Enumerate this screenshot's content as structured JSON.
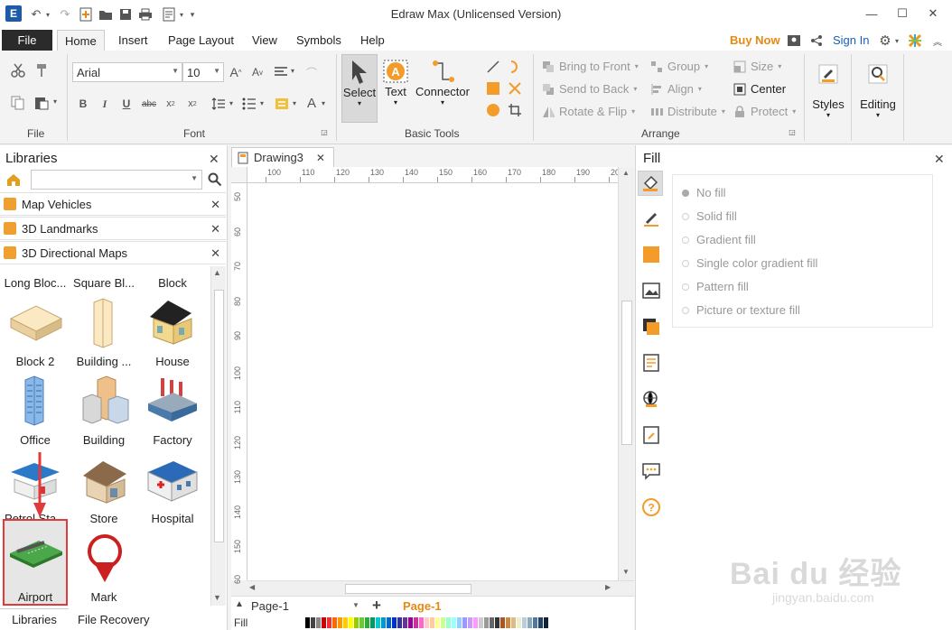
{
  "window": {
    "title": "Edraw Max (Unlicensed Version)",
    "logo_text": "E"
  },
  "menu": {
    "file": "File",
    "tabs": [
      "Home",
      "Insert",
      "Page Layout",
      "View",
      "Symbols",
      "Help"
    ],
    "buy_now": "Buy Now",
    "sign_in": "Sign In"
  },
  "ribbon": {
    "groups": {
      "file": "File",
      "font": "Font",
      "basic_tools": "Basic Tools",
      "arrange": "Arrange"
    },
    "font_name": "Arial",
    "font_size": "10",
    "tools": {
      "select": "Select",
      "text": "Text",
      "connector": "Connector"
    },
    "arrange": {
      "bring_to_front": "Bring to Front",
      "send_to_back": "Send to Back",
      "rotate_flip": "Rotate & Flip",
      "group": "Group",
      "align": "Align",
      "distribute": "Distribute",
      "size": "Size",
      "center": "Center",
      "protect": "Protect"
    },
    "styles": "Styles",
    "editing": "Editing"
  },
  "libraries": {
    "title": "Libraries",
    "categories": [
      "Map Vehicles",
      "3D Landmarks",
      "3D Directional Maps"
    ],
    "symbols": [
      {
        "label": "Long Bloc..."
      },
      {
        "label": "Square Bl..."
      },
      {
        "label": "Block"
      },
      {
        "label": "Block 2"
      },
      {
        "label": "Building ..."
      },
      {
        "label": "House"
      },
      {
        "label": "Office"
      },
      {
        "label": "Building"
      },
      {
        "label": "Factory"
      },
      {
        "label": "Petrol Sta..."
      },
      {
        "label": "Store"
      },
      {
        "label": "Hospital"
      },
      {
        "label": "Airport"
      },
      {
        "label": "Mark"
      }
    ],
    "bottom_tabs": [
      "Libraries",
      "File Recovery"
    ]
  },
  "document": {
    "tab": "Drawing3",
    "ruler_h": [
      "100",
      "110",
      "120",
      "130",
      "140",
      "150",
      "160",
      "170",
      "180",
      "190",
      "20"
    ],
    "ruler_v": [
      "50",
      "60",
      "70",
      "80",
      "90",
      "100",
      "110",
      "120",
      "130",
      "140",
      "150",
      "60"
    ],
    "page_select": "Page-1",
    "page_tab": "Page-1",
    "fill_label": "Fill"
  },
  "fill": {
    "title": "Fill",
    "options": [
      "No fill",
      "Solid fill",
      "Gradient fill",
      "Single color gradient fill",
      "Pattern fill",
      "Picture or texture fill"
    ]
  },
  "colors": {
    "accent_orange": "#f39c2a",
    "highlight_red": "#e03a3a"
  }
}
